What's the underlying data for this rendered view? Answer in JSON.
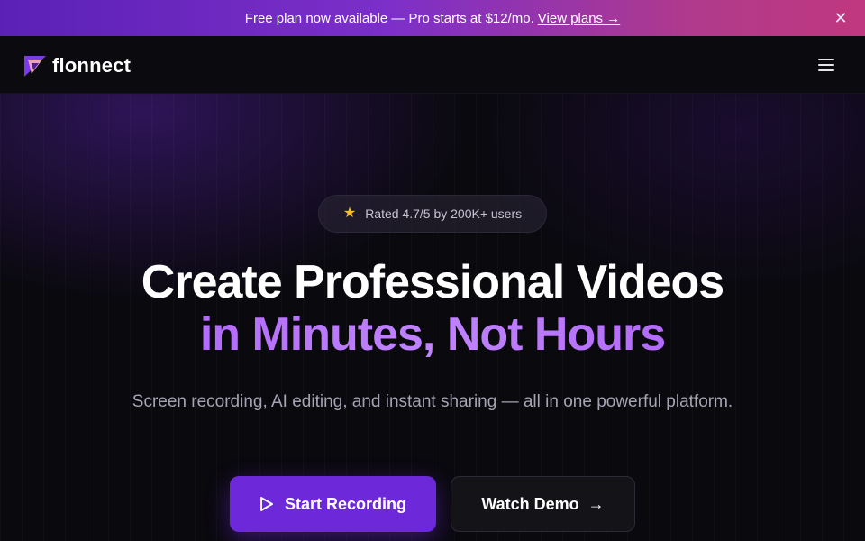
{
  "announcement": {
    "message": "Free plan now available — Pro starts at $12/mo.",
    "link_label": "View plans →",
    "close_icon": "close-icon"
  },
  "nav": {
    "brand": "flonnect",
    "logo_icon": "flonnect-logo",
    "menu_icon": "hamburger-menu-icon"
  },
  "hero": {
    "rating_text": "Rated 4.7/5 by 200K+ users",
    "rating_icon": "star-icon",
    "headline_line1": "Create Professional Videos",
    "headline_line2": "in Minutes, Not Hours",
    "subheadline": "Screen recording, AI editing, and instant sharing — all in one powerful platform.",
    "primary_cta": "Start Recording",
    "primary_cta_icon": "play-icon",
    "secondary_cta": "Watch Demo",
    "secondary_cta_icon": "arrow-right-icon"
  },
  "colors": {
    "accent": "#6d28d9",
    "headline_gradient": "#a855f7",
    "star": "#fbbf24",
    "background": "#0a090e"
  }
}
